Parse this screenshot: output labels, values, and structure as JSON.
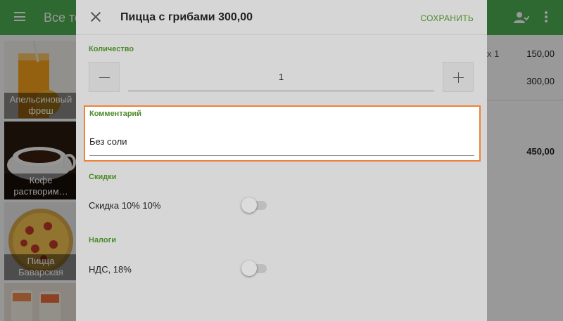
{
  "app_bar": {
    "title": "Все то",
    "icons": [
      "menu-icon",
      "person-icon",
      "more-vert-icon"
    ]
  },
  "products": [
    {
      "name": "Апельсиновый фреш"
    },
    {
      "name": "Кофе растворим…"
    },
    {
      "name": "Пицца Баварская"
    },
    {
      "name": ""
    }
  ],
  "order": {
    "qty_text": "x 1",
    "line1_amount": "150,00",
    "line2_amount": "300,00",
    "total": "450,00"
  },
  "dialog": {
    "title": "Пицца с грибами 300,00",
    "save_label": "СОХРАНИТЬ",
    "quantity": {
      "label": "Количество",
      "value": "1"
    },
    "comment": {
      "label": "Комментарий",
      "value": "Без соли"
    },
    "discounts": {
      "label": "Скидки",
      "items": [
        {
          "label": "Скидка 10% 10%",
          "enabled": false
        }
      ]
    },
    "taxes": {
      "label": "Налоги",
      "items": [
        {
          "label": "НДС, 18%",
          "enabled": false
        }
      ]
    }
  },
  "colors": {
    "accent_green": "#4c8c2b",
    "app_bar_green": "#4caf50",
    "highlight_orange": "#f0813a",
    "dialog_bg": "#d6d6d6"
  }
}
